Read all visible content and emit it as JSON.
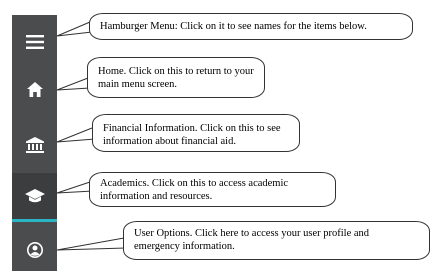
{
  "sidebar": {
    "items": [
      {
        "name": "hamburger-menu",
        "icon": "hamburger-icon"
      },
      {
        "name": "home",
        "icon": "home-icon"
      },
      {
        "name": "financial-information",
        "icon": "bank-icon"
      },
      {
        "name": "academics",
        "icon": "graduation-cap-icon",
        "active": true
      },
      {
        "name": "user-options",
        "icon": "user-icon"
      }
    ],
    "colors": {
      "background": "#4a4c4e",
      "active_background": "#3b3d3f",
      "active_indicator": "#2bb5c4",
      "icon": "#ffffff"
    }
  },
  "callouts": {
    "hamburger": "Hamburger Menu: Click on it to see names for the items below.",
    "home": "Home. Click on this to return to your main menu screen.",
    "financial": "Financial Information. Click on this to see information about financial aid.",
    "academics": "Academics. Click on this to access academic information and resources.",
    "user_options": "User Options. Click here to access your user profile and emergency information."
  }
}
